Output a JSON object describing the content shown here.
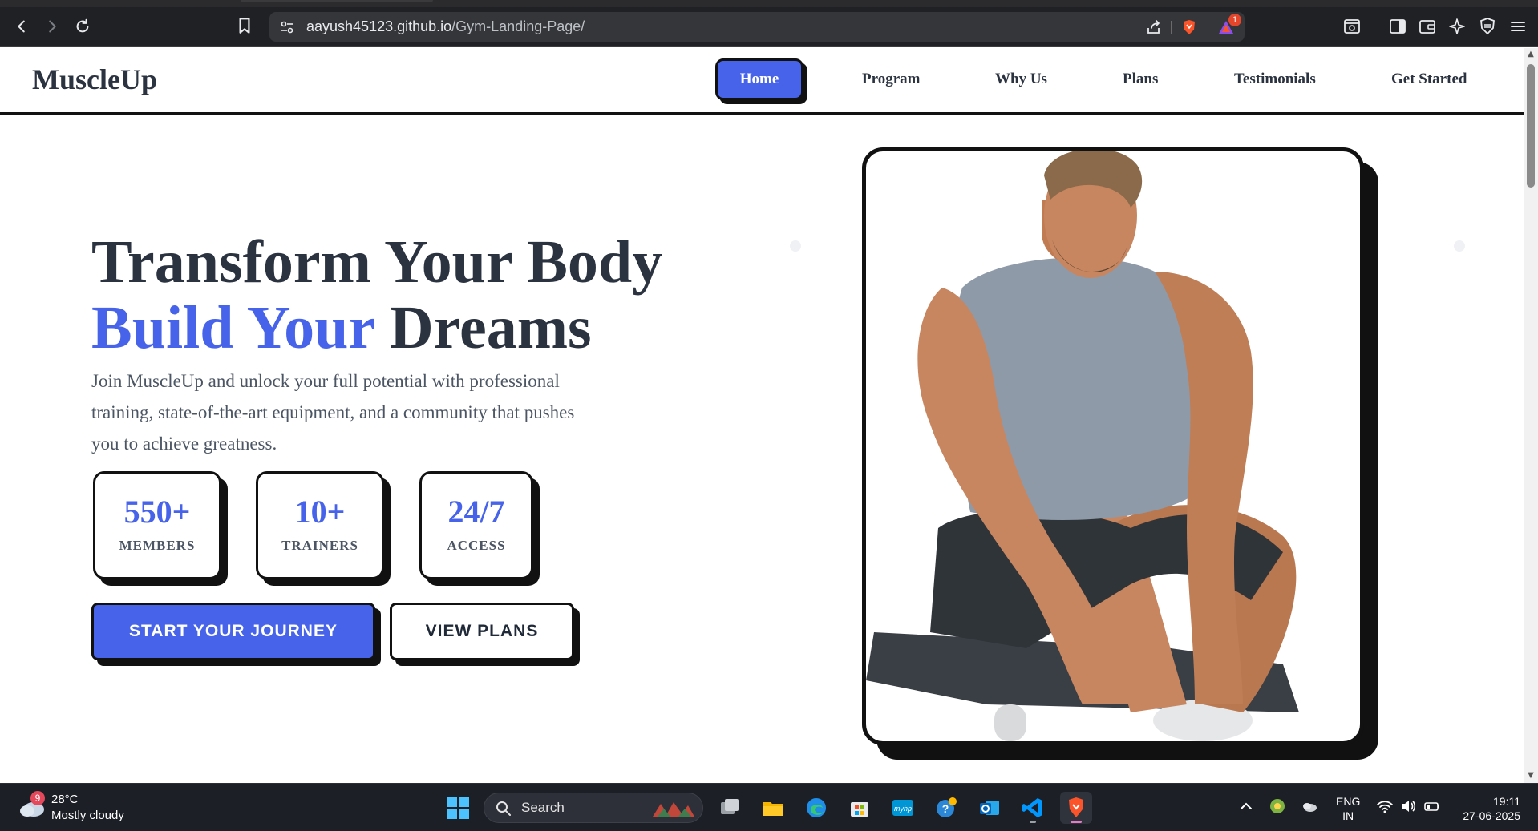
{
  "browser": {
    "url_host": "aayush45123.github.io",
    "url_path": "/Gym-Landing-Page/",
    "shields_badge": "1",
    "colors": {
      "chrome_bg": "#202124",
      "omnibox_bg": "#35363a",
      "brave_orange": "#fb542b"
    },
    "icons": [
      "back-icon",
      "forward-icon",
      "reload-icon",
      "bookmark-icon",
      "site-settings-icon",
      "share-icon",
      "brave-shields-icon",
      "brave-rewards-icon",
      "screenshot-icon",
      "sidebar-icon",
      "wallet-icon",
      "leo-ai-icon",
      "vpn-icon",
      "menu-icon"
    ]
  },
  "site": {
    "logo": "MuscleUp",
    "nav": {
      "home": "Home",
      "program": "Program",
      "why_us": "Why Us",
      "plans": "Plans",
      "testimonials": "Testimonials",
      "get_started": "Get Started"
    },
    "hero": {
      "title_line1": "Transform Your Body",
      "title_accent": "Build Your",
      "title_rest": " Dreams",
      "description": "Join MuscleUp and unlock your full potential with professional training, state-of-the-art equipment, and a community that pushes you to achieve greatness.",
      "stats": [
        {
          "value": "550+",
          "label": "MEMBERS"
        },
        {
          "value": "10+",
          "label": "TRAINERS"
        },
        {
          "value": "24/7",
          "label": "ACCESS"
        }
      ],
      "cta_primary": "START YOUR JOURNEY",
      "cta_secondary": "VIEW PLANS"
    },
    "colors": {
      "primary": "#4663e9",
      "dark": "#2b3340",
      "text": "#4b5563",
      "border": "#111111"
    }
  },
  "taskbar": {
    "weather": {
      "badge": "9",
      "temp": "28°C",
      "desc": "Mostly cloudy"
    },
    "search_label": "Search",
    "apps": [
      "task-view",
      "file-explorer",
      "edge",
      "microsoft-store",
      "myhp",
      "get-help",
      "outlook",
      "vscode",
      "brave"
    ],
    "tray": {
      "lang": "ENG",
      "region": "IN",
      "time": "19:11",
      "date": "27-06-2025"
    }
  }
}
